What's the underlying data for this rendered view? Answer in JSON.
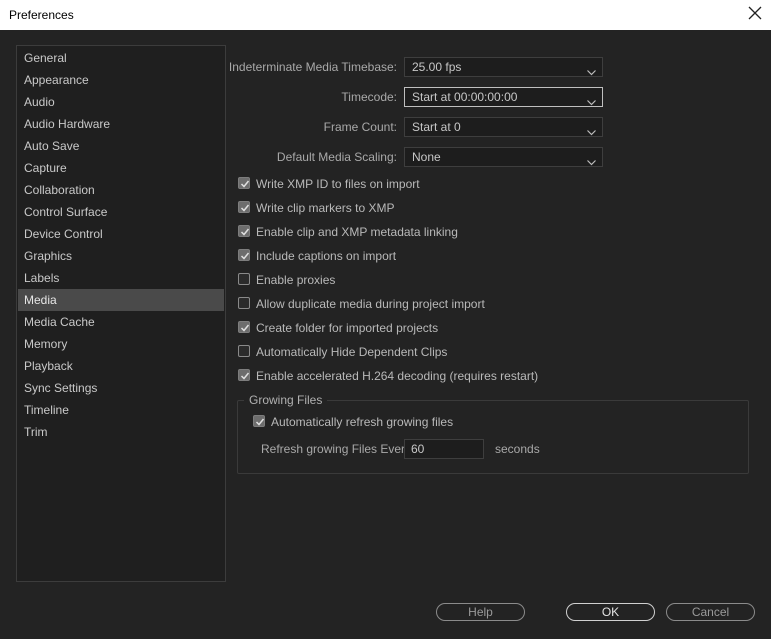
{
  "window": {
    "title": "Preferences"
  },
  "sidebar": {
    "items": [
      {
        "label": "General"
      },
      {
        "label": "Appearance"
      },
      {
        "label": "Audio"
      },
      {
        "label": "Audio Hardware"
      },
      {
        "label": "Auto Save"
      },
      {
        "label": "Capture"
      },
      {
        "label": "Collaboration"
      },
      {
        "label": "Control Surface"
      },
      {
        "label": "Device Control"
      },
      {
        "label": "Graphics"
      },
      {
        "label": "Labels"
      },
      {
        "label": "Media"
      },
      {
        "label": "Media Cache"
      },
      {
        "label": "Memory"
      },
      {
        "label": "Playback"
      },
      {
        "label": "Sync Settings"
      },
      {
        "label": "Timeline"
      },
      {
        "label": "Trim"
      }
    ],
    "selected": "Media"
  },
  "settings": {
    "timebase": {
      "label": "Indeterminate Media Timebase:",
      "value": "25.00 fps"
    },
    "timecode": {
      "label": "Timecode:",
      "value": "Start at 00:00:00:00"
    },
    "frame_count": {
      "label": "Frame Count:",
      "value": "Start at 0"
    },
    "scaling": {
      "label": "Default Media Scaling:",
      "value": "None"
    }
  },
  "checkboxes": [
    {
      "label": "Write XMP ID to files on import",
      "checked": true
    },
    {
      "label": "Write clip markers to XMP",
      "checked": true
    },
    {
      "label": "Enable clip and XMP metadata linking",
      "checked": true
    },
    {
      "label": "Include captions on import",
      "checked": true
    },
    {
      "label": "Enable proxies",
      "checked": false
    },
    {
      "label": "Allow duplicate media during project import",
      "checked": false
    },
    {
      "label": "Create folder for imported projects",
      "checked": true
    },
    {
      "label": "Automatically Hide Dependent Clips",
      "checked": false
    },
    {
      "label": "Enable accelerated H.264 decoding (requires restart)",
      "checked": true
    }
  ],
  "growing_files": {
    "title": "Growing Files",
    "auto_refresh": {
      "label": "Automatically refresh growing files",
      "checked": true
    },
    "refresh_label": "Refresh growing Files Every",
    "refresh_value": "60",
    "refresh_unit": "seconds"
  },
  "buttons": {
    "help": "Help",
    "ok": "OK",
    "cancel": "Cancel"
  },
  "colors": {
    "background": "#232323",
    "sidebar_selected": "#4a4a4a",
    "text": "#b9b9b9"
  }
}
